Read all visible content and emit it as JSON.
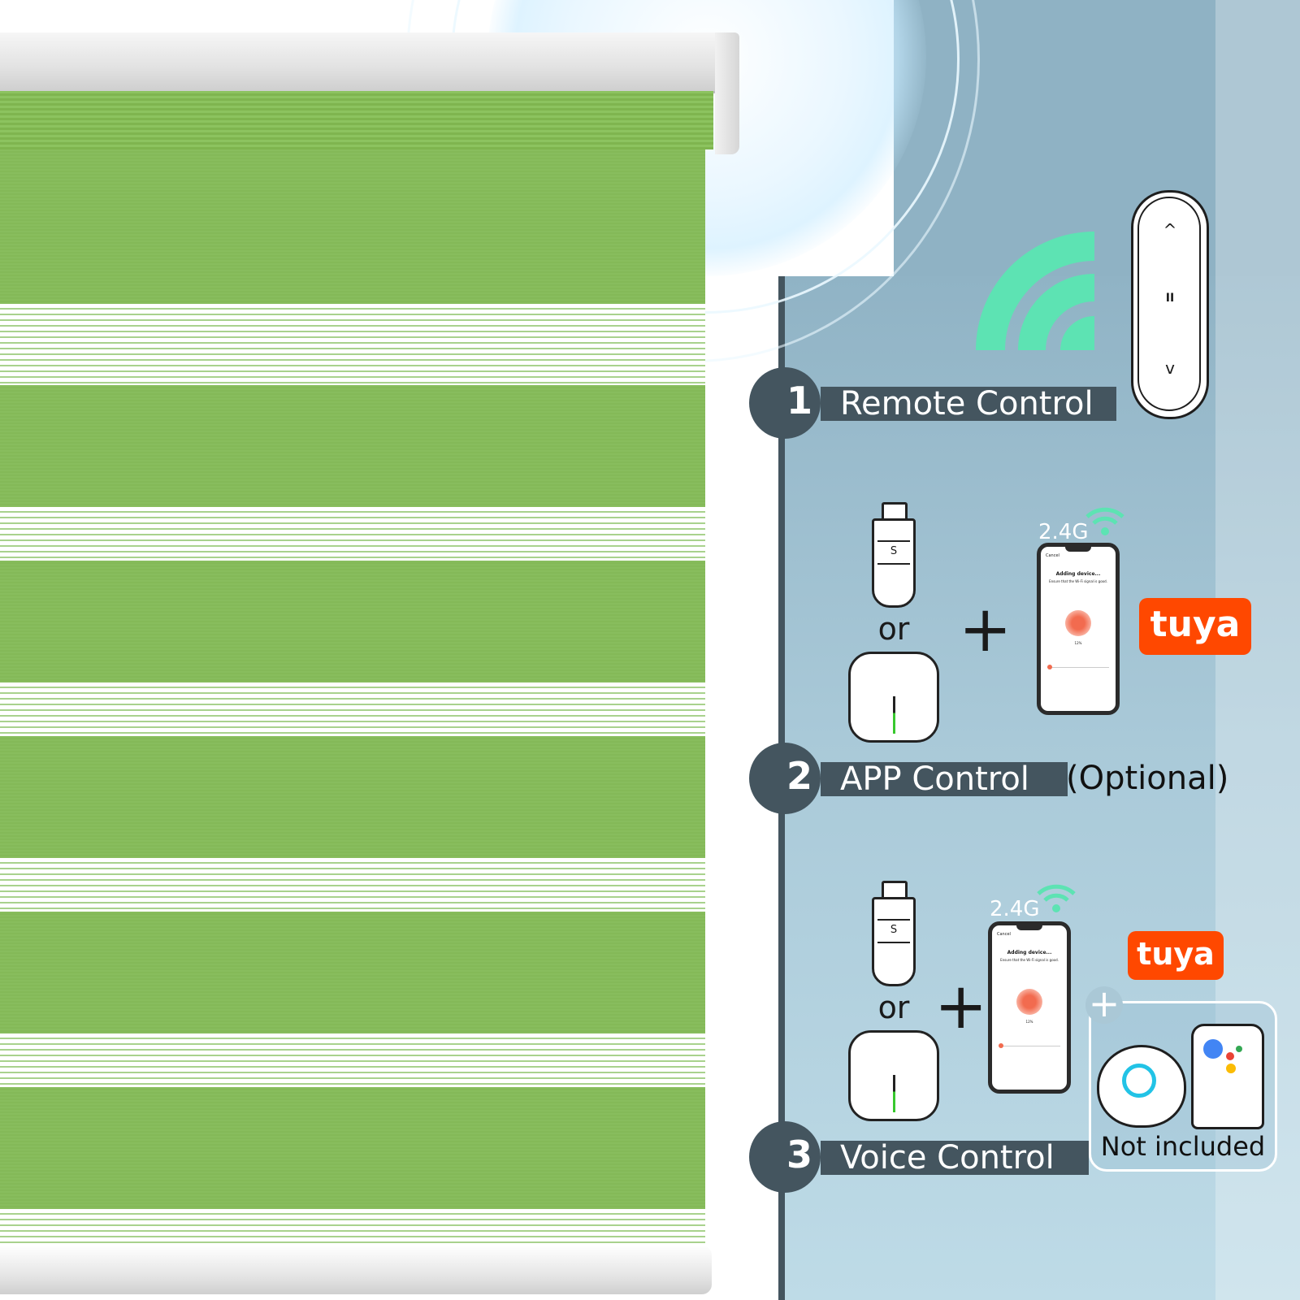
{
  "features": [
    {
      "number": "1",
      "label": "Remote Control"
    },
    {
      "number": "2",
      "label": "APP Control",
      "suffix": "(Optional)"
    },
    {
      "number": "3",
      "label": "Voice Control"
    }
  ],
  "or_label": "or",
  "band_label": "2.4G",
  "brand_logo": "tuya",
  "not_included_label": "Not included",
  "remote_buttons": [
    "^",
    "II",
    "v"
  ],
  "phone_screen": {
    "cancel": "Cancel",
    "title": "Adding device...",
    "hint": "Ensure that the Wi-Fi signal is good.",
    "progress": "12%"
  },
  "usb_button": "S",
  "icons": [
    "wifi-signal-icon",
    "remote-control-icon",
    "usb-dongle-icon",
    "gateway-hub-icon",
    "phone-icon",
    "alexa-speaker-icon",
    "google-home-icon",
    "plus-icon"
  ],
  "colors": {
    "blind_green": "#88bd5d",
    "panel_dark": "#44555f",
    "signal_teal": "#5de3b3",
    "tuya_orange": "#ff4800"
  }
}
